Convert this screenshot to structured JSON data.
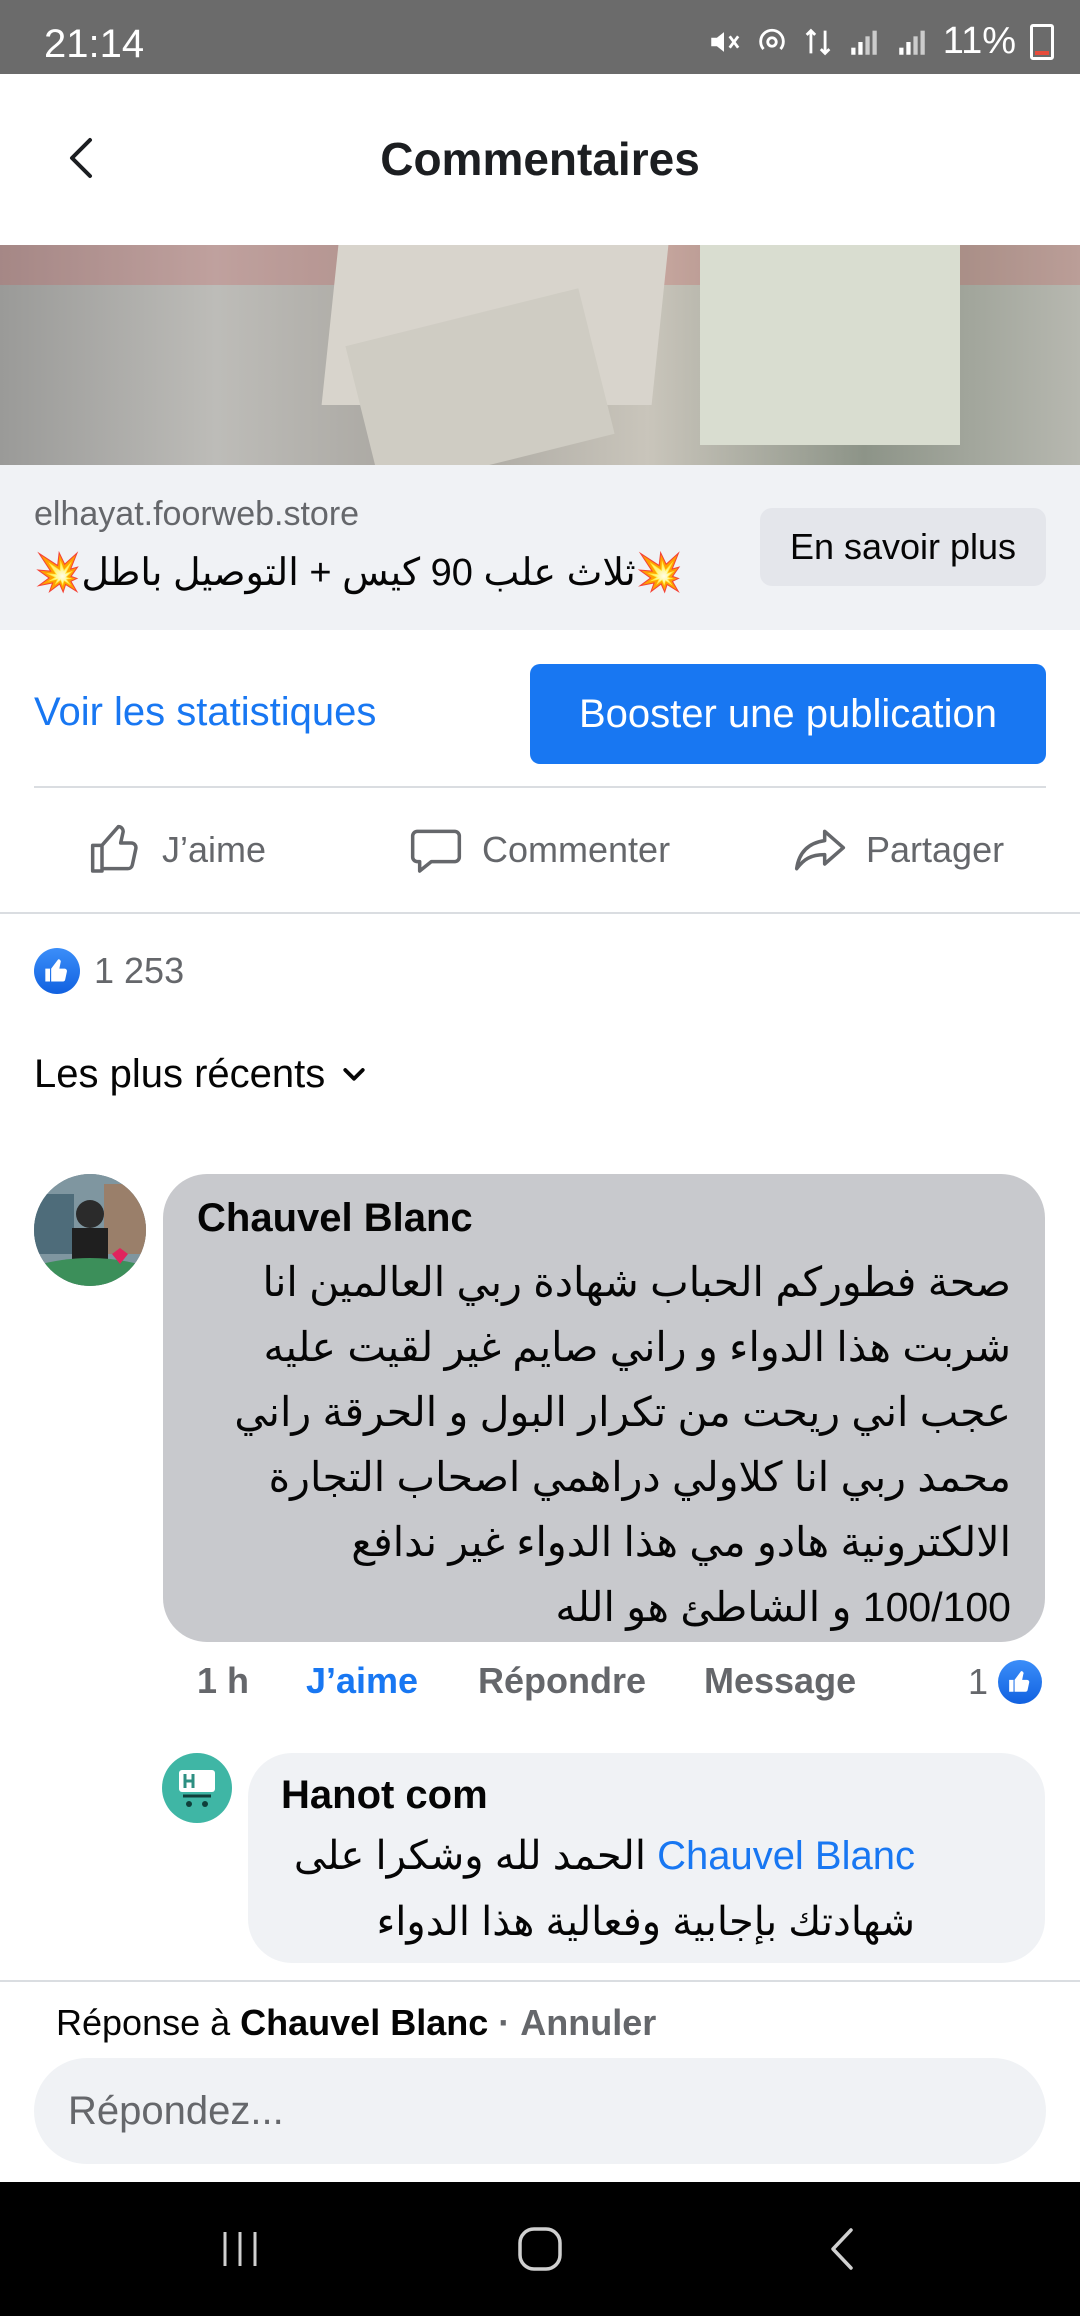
{
  "status_bar": {
    "time": "21:14",
    "battery": "11%"
  },
  "header": {
    "title": "Commentaires"
  },
  "link_preview": {
    "domain": "elhayat.foorweb.store",
    "title": "💥ثلاث علب 90 كيس + التوصيل باطل💥",
    "cta": "En savoir plus"
  },
  "post_actions": {
    "stats": "Voir les statistiques",
    "boost": "Booster une publication",
    "like": "J’aime",
    "comment": "Commenter",
    "share": "Partager"
  },
  "reactions": {
    "count": "1 253"
  },
  "sort": {
    "label": "Les plus récents"
  },
  "comment": {
    "author": "Chauvel Blanc",
    "text": "صحة فطوركم الحباب شهادة ربي العالمين انا شربت هذا الدواء و راني صايم غير لقيت عليه عجب اني ريحت من تكرار البول و الحرقة راني محمد ربي انا كلاولي دراهمي اصحاب التجارة الالكترونية هادو مي هذا الدواء غير ندافع 100/100 و الشاطئ هو الله",
    "time": "1 h",
    "like": "J’aime",
    "reply": "Répondre",
    "message": "Message",
    "like_count": "1"
  },
  "reply": {
    "author": "Hanot com",
    "mention": "Chauvel Blanc",
    "text": "الحمد لله وشكرا على شهادتك بإجابية وفعالية هذا الدواء"
  },
  "composer": {
    "prefix": "Réponse à",
    "target": "Chauvel Blanc",
    "separator": "·",
    "cancel": "Annuler",
    "placeholder": "Répondez..."
  },
  "colors": {
    "accent": "#1877f2",
    "bubble": "#c8c9cd",
    "secondary_text": "#65676b"
  }
}
